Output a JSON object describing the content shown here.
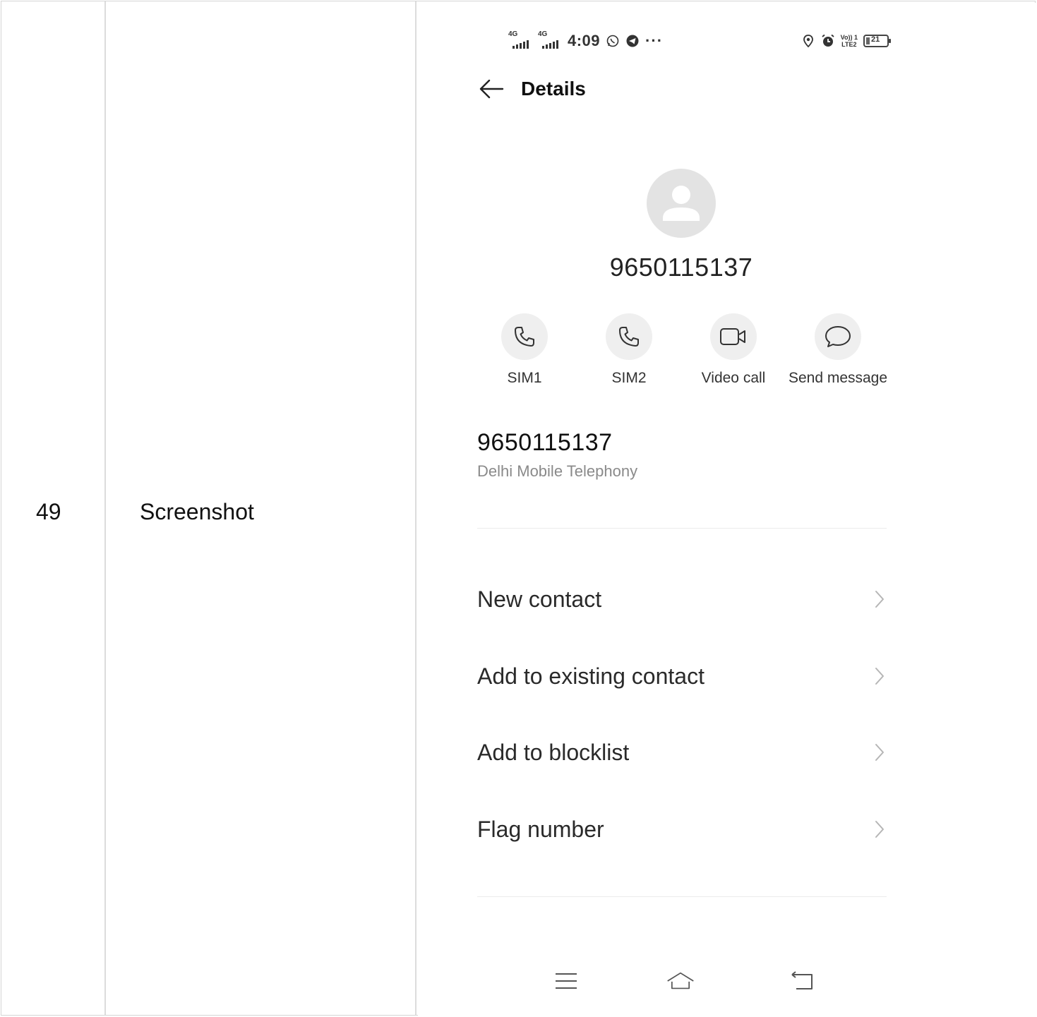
{
  "table": {
    "row_number": "49",
    "row_label": "Screenshot"
  },
  "status_bar": {
    "sim1_network": "4G",
    "sim2_network": "4G",
    "time": "4:09",
    "more": "···",
    "volte_top": "Vo)) 1",
    "volte_bottom": "LTE2",
    "battery_percent": "21",
    "icons": [
      "whatsapp-icon",
      "telegram-icon",
      "location-icon",
      "alarm-icon"
    ]
  },
  "header": {
    "title": "Details"
  },
  "contact": {
    "number": "9650115137"
  },
  "actions": [
    {
      "label": "SIM1",
      "icon": "phone-icon"
    },
    {
      "label": "SIM2",
      "icon": "phone-icon"
    },
    {
      "label": "Video call",
      "icon": "video-camera-icon"
    },
    {
      "label": "Send message",
      "icon": "message-bubble-icon"
    }
  ],
  "number_info": {
    "number": "9650115137",
    "carrier": "Delhi Mobile Telephony"
  },
  "menu": [
    {
      "label": "New contact"
    },
    {
      "label": "Add to existing contact"
    },
    {
      "label": "Add to blocklist"
    },
    {
      "label": "Flag number"
    }
  ],
  "colors": {
    "avatar_bg": "#e3e3e3",
    "action_circle_bg": "#efefef",
    "secondary_text": "#8a8a8a",
    "divider": "#ececec"
  }
}
